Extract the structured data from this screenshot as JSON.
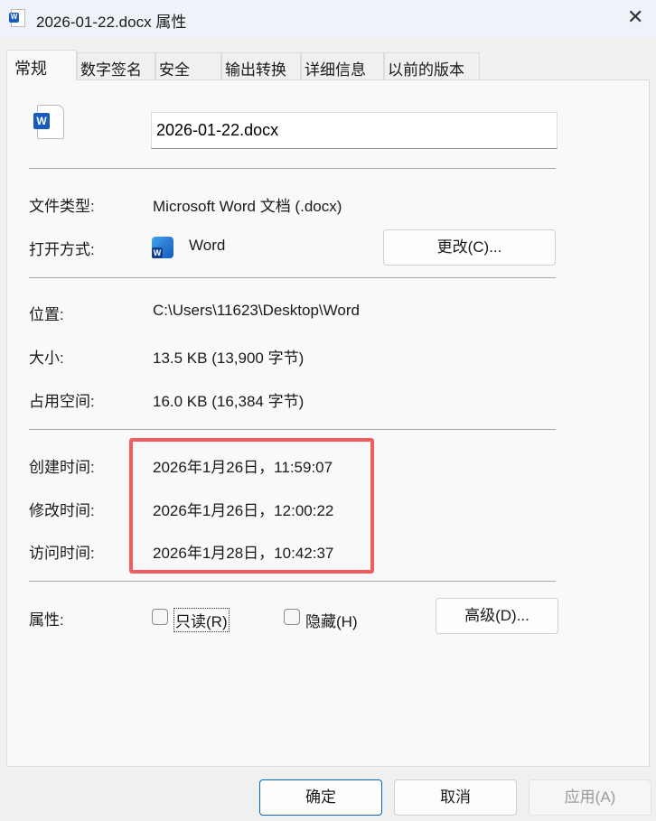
{
  "window": {
    "title": "2026-01-22.docx 属性",
    "close_icon": "close-icon"
  },
  "tabs": [
    {
      "label": "常规"
    },
    {
      "label": "数字签名"
    },
    {
      "label": "安全"
    },
    {
      "label": "输出转换"
    },
    {
      "label": "详细信息"
    },
    {
      "label": "以前的版本"
    }
  ],
  "general": {
    "filename": "2026-01-22.docx",
    "file_type_label": "文件类型:",
    "file_type": "Microsoft Word 文档 (.docx)",
    "open_with_label": "打开方式:",
    "open_with": "Word",
    "change_button": "更改(C)...",
    "location_label": "位置:",
    "location": "C:\\Users\\11623\\Desktop\\Word",
    "size_label": "大小:",
    "size": "13.5 KB (13,900 字节)",
    "disk_size_label": "占用空间:",
    "disk_size": "16.0 KB (16,384 字节)",
    "created_label": "创建时间:",
    "created": "2026年1月26日，11:59:07",
    "modified_label": "修改时间:",
    "modified": "2026年1月26日，12:00:22",
    "accessed_label": "访问时间:",
    "accessed": "2026年1月28日，10:42:37",
    "attributes_label": "属性:",
    "readonly_label": "只读(R)",
    "hidden_label": "隐藏(H)",
    "advanced_button": "高级(D)..."
  },
  "footer": {
    "ok": "确定",
    "cancel": "取消",
    "apply": "应用(A)"
  },
  "colors": {
    "highlight": "#f25c5c",
    "ok_border": "#0067c0",
    "word_blue": "#185abd"
  }
}
